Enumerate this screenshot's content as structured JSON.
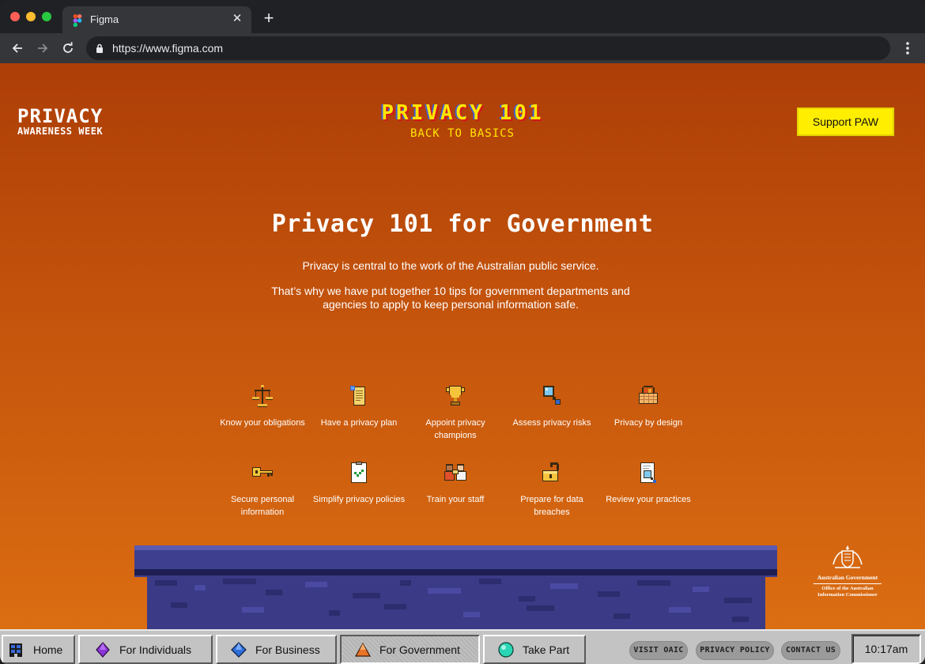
{
  "browser": {
    "tab_title": "Figma",
    "url": "https://www.figma.com",
    "tab_close": "✕",
    "new_tab": "+"
  },
  "site": {
    "logo_line1": "PRIVACY",
    "logo_line2": "AWARENESS WEEK",
    "hero_line1": "PRIVACY 101",
    "hero_line2": "BACK TO BASICS",
    "support_button": "Support PAW"
  },
  "main": {
    "title": "Privacy 101 for Government",
    "intro_1": "Privacy is central to the work of the Australian public service.",
    "intro_2": "That’s why we have put together 10 tips for government departments and agencies to apply to keep personal information safe.",
    "tips": [
      {
        "label": "Know your obligations",
        "icon": "scales-icon"
      },
      {
        "label": "Have a privacy plan",
        "icon": "scroll-icon"
      },
      {
        "label": "Appoint privacy champions",
        "icon": "trophy-icon"
      },
      {
        "label": "Assess privacy risks",
        "icon": "magnifier-icon"
      },
      {
        "label": "Privacy by design",
        "icon": "basket-icon"
      },
      {
        "label": "Secure personal information",
        "icon": "key-icon"
      },
      {
        "label": "Simplify privacy policies",
        "icon": "checklist-icon"
      },
      {
        "label": "Train your staff",
        "icon": "people-icon"
      },
      {
        "label": "Prepare for data breaches",
        "icon": "padlock-icon"
      },
      {
        "label": "Review your practices",
        "icon": "document-search-icon"
      }
    ]
  },
  "gov": {
    "line1": "Australian Government",
    "line2": "Office of the Australian",
    "line3": "Information Commissioner"
  },
  "taskbar": {
    "home": "Home",
    "individuals": "For Individuals",
    "business": "For Business",
    "government": "For Government",
    "take_part": "Take Part",
    "visit_oaic": "VISIT OAIC",
    "privacy_policy": "PRIVACY POLICY",
    "contact_us": "CONTACT US",
    "clock": "10:17am"
  },
  "colors": {
    "accent_yellow": "#ffee00",
    "page_top": "#ad3e07",
    "page_bottom": "#db6d12",
    "wall": "#3a3a86"
  }
}
